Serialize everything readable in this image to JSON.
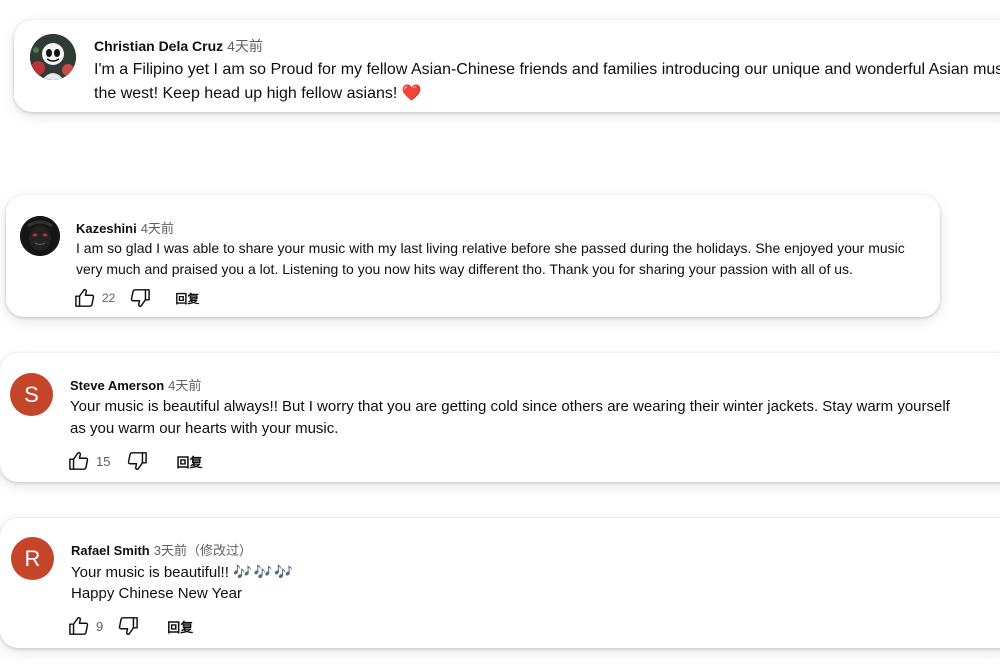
{
  "comments": [
    {
      "author": "Christian Dela Cruz",
      "time": "4天前",
      "line1": "I'm a Filipino yet I am so Proud for my fellow Asian-Chinese friends and families introducing our unique and wonderful Asian music to",
      "line2": "the west! Keep head up high fellow asians!",
      "emoji": "❤️",
      "avatar_icon": "masked-figure-avatar"
    },
    {
      "author": "Kazeshini",
      "time": "4天前",
      "line1": "I am so glad I was able to share your music with my last living relative before she passed during the holidays. She enjoyed your music",
      "line2": "very much and praised you a lot. Listening to you now hits way different tho. Thank you for sharing your passion with all of us.",
      "likes": "22",
      "reply_label": "回复",
      "avatar_icon": "dark-face-avatar"
    },
    {
      "author": "Steve Amerson",
      "time": "4天前",
      "line1": "Your music is beautiful always!!  But I worry that you are getting cold since others are wearing their winter jackets.  Stay warm yourself",
      "line2": "as you warm our hearts with your music.",
      "likes": "15",
      "reply_label": "回复",
      "avatar_letter": "S",
      "avatar_color": "#c5452a"
    },
    {
      "author": "Rafael Smith",
      "time": "3天前（修改过）",
      "line1": "Your music is beautiful!!",
      "notes": "🎶🎶🎶",
      "line2": "Happy Chinese New Year",
      "likes": "9",
      "reply_label": "回复",
      "avatar_letter": "R",
      "avatar_color": "#c5452a"
    }
  ]
}
